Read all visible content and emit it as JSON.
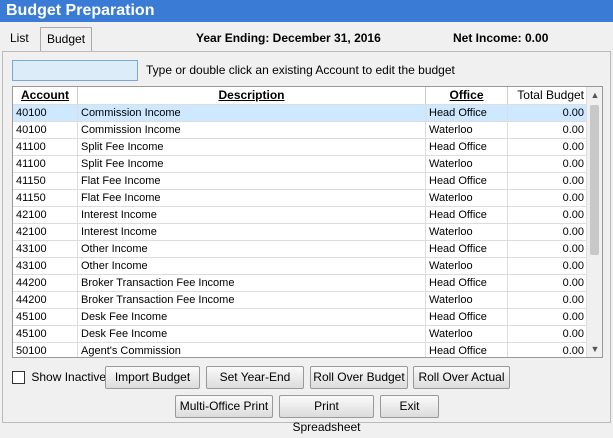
{
  "window": {
    "title": "Budget Preparation"
  },
  "tabs": [
    {
      "label": "List"
    },
    {
      "label": "Budget"
    }
  ],
  "header": {
    "year_ending": "Year Ending: December 31, 2016",
    "net_income": "Net Income: 0.00"
  },
  "search": {
    "value": "",
    "hint": "Type or double click an existing Account to edit the budget"
  },
  "grid": {
    "columns": [
      "Account",
      "Description",
      "Office",
      "Total Budget"
    ],
    "rows": [
      {
        "account": "40100",
        "description": "Commission Income",
        "office": "Head Office",
        "total": "0.00",
        "selected": true
      },
      {
        "account": "40100",
        "description": "Commission Income",
        "office": "Waterloo",
        "total": "0.00"
      },
      {
        "account": "41100",
        "description": "Split Fee Income",
        "office": "Head Office",
        "total": "0.00"
      },
      {
        "account": "41100",
        "description": "Split Fee Income",
        "office": "Waterloo",
        "total": "0.00"
      },
      {
        "account": "41150",
        "description": "Flat Fee Income",
        "office": "Head Office",
        "total": "0.00"
      },
      {
        "account": "41150",
        "description": "Flat Fee Income",
        "office": "Waterloo",
        "total": "0.00"
      },
      {
        "account": "42100",
        "description": "Interest Income",
        "office": "Head Office",
        "total": "0.00"
      },
      {
        "account": "42100",
        "description": "Interest Income",
        "office": "Waterloo",
        "total": "0.00"
      },
      {
        "account": "43100",
        "description": "Other Income",
        "office": "Head Office",
        "total": "0.00"
      },
      {
        "account": "43100",
        "description": "Other Income",
        "office": "Waterloo",
        "total": "0.00"
      },
      {
        "account": "44200",
        "description": "Broker Transaction Fee Income",
        "office": "Head Office",
        "total": "0.00"
      },
      {
        "account": "44200",
        "description": "Broker Transaction Fee Income",
        "office": "Waterloo",
        "total": "0.00"
      },
      {
        "account": "45100",
        "description": "Desk Fee Income",
        "office": "Head Office",
        "total": "0.00"
      },
      {
        "account": "45100",
        "description": "Desk Fee Income",
        "office": "Waterloo",
        "total": "0.00"
      },
      {
        "account": "50100",
        "description": "Agent's Commission",
        "office": "Head Office",
        "total": "0.00"
      }
    ]
  },
  "controls": {
    "show_inactive_label": "Show Inactive",
    "show_inactive_checked": false,
    "buttons": {
      "import_budget": "Import Budget",
      "set_year_end": "Set Year-End",
      "roll_over_budget": "Roll Over Budget",
      "roll_over_actual": "Roll Over Actual",
      "multi_office_print": "Multi-Office Print",
      "print_spreadsheet": "Print Spreadsheet",
      "exit": "Exit"
    }
  },
  "colors": {
    "titlebar": "#3a7bd5",
    "selected_row": "#cde8ff",
    "search_bg": "#dcecf8"
  }
}
